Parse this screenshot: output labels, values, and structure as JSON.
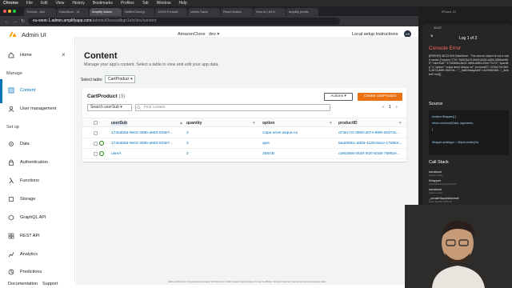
{
  "menubar": {
    "app": "Chrome",
    "items": [
      "File",
      "Edit",
      "View",
      "History",
      "Bookmarks",
      "Profiles",
      "Tab",
      "Window",
      "Help"
    ]
  },
  "browser": {
    "tabs": [
      "Tutorial - Adc",
      "DataStore - Vr",
      "Amplify Admin",
      "NetfilxClone(y",
      "JSON Formatt",
      "Vadim Savin",
      "React Native",
      "How to | let D",
      "amplify predic"
    ],
    "active_tab": 2,
    "url_host": "eu-west-1.admin.amplifyapp.com",
    "url_path": "/admin/d3wxsadbgn1elz/dev/content"
  },
  "header": {
    "title": "Admin UI",
    "app_name": "AmazonClone",
    "env": "dev",
    "local_setup": "Local setup instructions",
    "avatar": "VS"
  },
  "sidebar": {
    "home": "Home",
    "manage_section": "Manage",
    "manage_items": [
      "Content",
      "User management"
    ],
    "setup_section": "Set up",
    "setup_items": [
      "Data",
      "Authentication",
      "Functions",
      "Storage",
      "GraphQL API",
      "REST API",
      "Analytics",
      "Predictions"
    ],
    "bottom": [
      "Documentation",
      "Support"
    ]
  },
  "main": {
    "title": "Content",
    "description": "Manage your app's content. Select a table to view and edit your app data.",
    "select_label": "Select table:",
    "select_value": "CartProduct",
    "panel_title": "CartProduct",
    "panel_count": "(3)",
    "actions_label": "Actions",
    "create_label": "Create cartProduct",
    "search_field": "Search userSub",
    "filter_placeholder": "Find content",
    "page": "1",
    "columns": [
      "userSub",
      "quantity",
      "option",
      "productID"
    ],
    "rows": [
      {
        "userSub": "173edb5d-8e02-469b-a583-033e7...",
        "quantity": "2",
        "option": "culpa amet aliqua nu",
        "productID": "d74ec7cf-0b50-4074-89f9-2647dc..."
      },
      {
        "userSub": "173edb5d-8e02-469b-a583-033e7...",
        "quantity": "2",
        "option": "quis",
        "productID": "5aa006bc-d84d-4125-8a1e-17d9be..."
      },
      {
        "userSub": "userA",
        "quantity": "2",
        "option": "256GB",
        "productID": "caf62db6-0538-4f20-b0d5-76992e..."
      }
    ]
  },
  "footer": {
    "text": "AWS Amplify Admin UI is powered by Amazon Web Services © 2020, Amazon Web Services, Inc. and its affiliates. All rights reserved. View the site terms and privacy policy."
  },
  "phone": {
    "label": "iPhone 12",
    "status": "10:27",
    "log_title": "Log 1 of 2",
    "error_title": "Console Error",
    "error_body": "[ERROR] 38:23.519 DataStore - The source object is not a valid model {\"source\":{\"id\":\"06023a70-8e59-8d39-a55e-9858ae885\",\"userSub\":\"173edb5d-8e02-469b-a583-033e77c74\",\"quantity\":2,\"option\":\"culpa amet aliqua nu\",\"productID\":\"d74ec7cf-0b50-4074-89f9-2647dc...\",\"_lastChangedAt\":1624060388...\"_deleted\":null}}",
    "source_title": "Source",
    "source_lines": [
      "function Wrapper() {",
      "  return construct(Class, arguments,",
      "}",
      "",
      "Wrapper.prototype = Object.create(Cla"
    ],
    "stack_title": "Call Stack",
    "frames": [
      {
        "name": "construct",
        "sub": "(native code)"
      },
      {
        "name": "Wrapper",
        "sub": "wrapNativeSuper.js:26:19"
      },
      {
        "name": "construct",
        "sub": "(native code)"
      },
      {
        "name": "_createSuperInternal",
        "sub": "index.bundle:2156:29"
      }
    ]
  },
  "colors": {
    "accent": "#0073bb",
    "create": "#ec7211",
    "error": "#ff6b5b",
    "ok": "#1d8102"
  }
}
